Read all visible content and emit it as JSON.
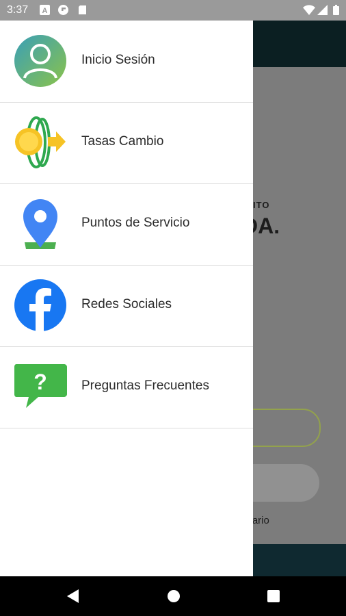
{
  "status_bar": {
    "time": "3:37",
    "left_icons": [
      "a-notification-icon",
      "flipboard-icon",
      "sim-card-icon"
    ],
    "right_icons": [
      "wifi-icon",
      "signal-icon",
      "battery-icon"
    ]
  },
  "drawer": {
    "items": [
      {
        "label": "Inicio Sesión",
        "icon": "user-avatar-icon"
      },
      {
        "label": "Tasas Cambio",
        "icon": "coin-exchange-icon"
      },
      {
        "label": "Puntos de Servicio",
        "icon": "location-pin-icon"
      },
      {
        "label": "Redes Sociales",
        "icon": "facebook-icon"
      },
      {
        "label": "Preguntas Frecuentes",
        "icon": "question-chat-icon"
      }
    ]
  },
  "background_app": {
    "small_text": "ÉDITO",
    "big_text": "DA.",
    "usuario_text": "suario"
  },
  "colors": {
    "status_bar": "#9a9a9a",
    "scrim": "#7c7c7c",
    "header_dark": "#0b1f22",
    "accent_green": "#4caf50",
    "facebook_blue": "#1877f2",
    "maps_blue": "#4285f4"
  },
  "nav_bar": {
    "buttons": [
      "back-icon",
      "home-icon",
      "recents-icon"
    ]
  }
}
